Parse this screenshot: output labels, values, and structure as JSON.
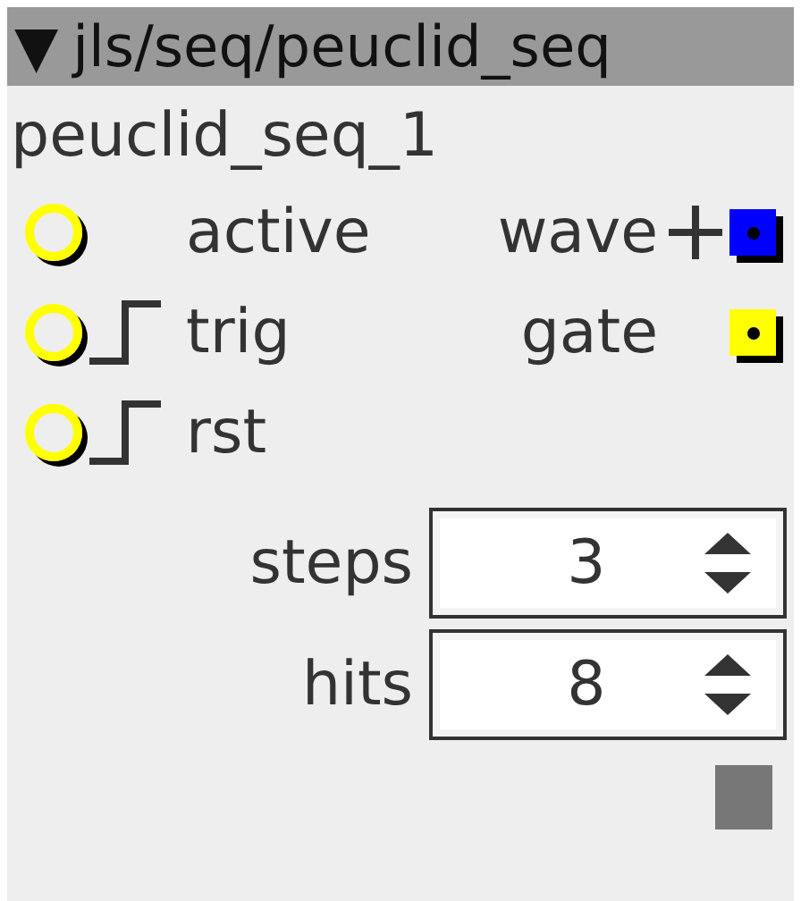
{
  "object": {
    "title": "jls/seq/peuclid_seq",
    "collapse_glyph": "▼",
    "instance_name": "peuclid_seq_1"
  },
  "inlets": [
    {
      "label": "active",
      "kind": "plain",
      "color": "#ffff00"
    },
    {
      "label": "trig",
      "kind": "trigger",
      "color": "#ffff00"
    },
    {
      "label": "rst",
      "kind": "trigger",
      "color": "#ffff00"
    }
  ],
  "outlets": [
    {
      "label": "wave",
      "bipolar": true,
      "color": "#0000ff"
    },
    {
      "label": "gate",
      "bipolar": false,
      "color": "#ffff00"
    }
  ],
  "parameters": [
    {
      "label": "steps",
      "value": "3"
    },
    {
      "label": "hits",
      "value": "8"
    }
  ]
}
